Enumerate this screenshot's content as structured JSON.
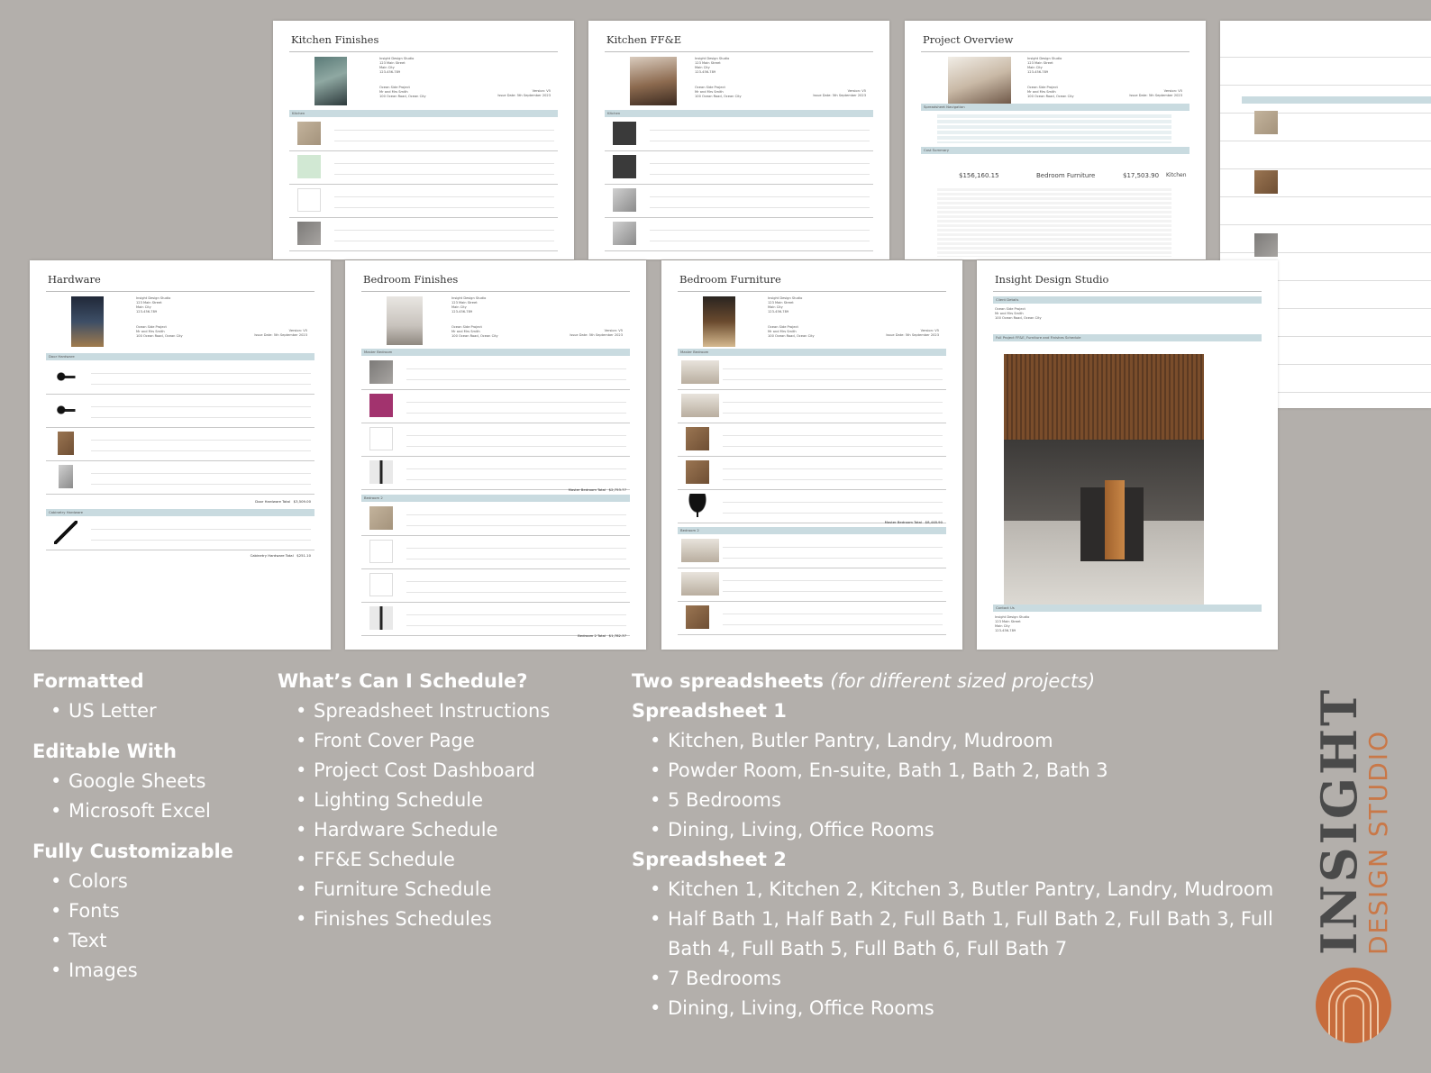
{
  "pages": {
    "kitchen_finishes": {
      "title": "Kitchen Finishes",
      "section": "Kitchen",
      "address": "Insight Design Studio\n123 Main Street\nMain City\n123-456-789",
      "project": "Ocean Side Project\nMr and Mrs Smith\n100 Ocean Road, Ocean City",
      "version": "Version: V5\nIssue Date: 5th September 2023"
    },
    "kitchen_ffe": {
      "title": "Kitchen FF&E",
      "section": "Kitchen",
      "address": "Insight Design Studio\n123 Main Street\nMain City\n123-456-789",
      "project": "Ocean Side Project\nMr and Mrs Smith\n100 Ocean Road, Ocean City",
      "version": "Version: V5\nIssue Date: 5th September 2023"
    },
    "project_overview": {
      "title": "Project Overview",
      "address": "Insight Design Studio\n123 Main Street\nMain City\n123-456-789",
      "project": "Ocean Side Project\nMr and Mrs Smith\n100 Ocean Road, Ocean City",
      "version": "Version: V5\nIssue Date: 5th September 2023",
      "nav_label": "Spreadsheet Navigation",
      "cost_label": "Cost Summary",
      "total_cost": "$156,160.15",
      "biggest_area": "Bedroom Furniture",
      "biggest_value": "$17,503.90",
      "biggest_room": "Kitchen"
    },
    "hardware": {
      "title": "Hardware",
      "section_1": "Door Hardware",
      "section_2": "Cabinetry Hardware",
      "address": "Insight Design Studio\n123 Main Street\nMain City\n123-456-789",
      "project": "Ocean Side Project\nMr and Mrs Smith\n100 Ocean Road, Ocean City",
      "version": "Version: V5\nIssue Date: 5th September 2023",
      "total_1_label": "Door Hardware Total",
      "total_1": "$3,509.00",
      "total_2_label": "Cabinetry Hardware Total",
      "total_2": "$251.10"
    },
    "bedroom_finishes": {
      "title": "Bedroom Finishes",
      "section_1": "Master Bedroom",
      "section_2": "Bedroom 2",
      "address": "Insight Design Studio\n123 Main Street\nMain City\n123-456-789",
      "project": "Ocean Side Project\nMr and Mrs Smith\n100 Ocean Road, Ocean City",
      "version": "Version: V5\nIssue Date: 5th September 2023",
      "total_1_label": "Master Bedroom Total",
      "total_1": "$2,753.77",
      "total_2_label": "Bedroom 2 Total",
      "total_2": "$1,782.37"
    },
    "bedroom_furniture": {
      "title": "Bedroom Furniture",
      "section_1": "Master Bedroom",
      "section_2": "Bedroom 2",
      "address": "Insight Design Studio\n123 Main Street\nMain City\n123-456-789",
      "project": "Ocean Side Project\nMr and Mrs Smith\n100 Ocean Road, Ocean City",
      "version": "Version: V5\nIssue Date: 5th September 2023",
      "total_1_label": "Master Bedroom Total",
      "total_1": "$8,448.90"
    },
    "cover": {
      "title": "Insight Design Studio",
      "client_label": "Client Details",
      "client": "Ocean Side Project\nMr and Mrs Smith\n100 Ocean Road, Ocean City",
      "schedule_label": "Full Project FF&E, Furniture and Finishes Schedule",
      "contact_label": "Contact Us",
      "contact": "Insight Design Studio\n123 Main Street\nMain City\n123-456-789"
    }
  },
  "col1": {
    "formatted_heading": "Formatted",
    "formatted_items": [
      "US Letter"
    ],
    "editable_heading": "Editable With",
    "editable_items": [
      "Google Sheets",
      "Microsoft Excel"
    ],
    "custom_heading": "Fully Customizable",
    "custom_items": [
      "Colors",
      "Fonts",
      "Text",
      "Images"
    ]
  },
  "col2": {
    "heading": "What’s Can I Schedule?",
    "items": [
      "Spreadsheet Instructions",
      "Front Cover Page",
      "Project Cost Dashboard",
      "Lighting Schedule",
      "Hardware Schedule",
      "FF&E Schedule",
      "Furniture Schedule",
      "Finishes Schedules"
    ]
  },
  "col3": {
    "heading": "Two spreadsheets",
    "heading_note": "(for different sized projects)",
    "s1_heading": "Spreadsheet 1",
    "s1_items": [
      "Kitchen, Butler Pantry, Landry, Mudroom",
      "Powder Room, En-suite, Bath 1, Bath 2, Bath 3",
      "5 Bedrooms",
      "Dining, Living, Office Rooms"
    ],
    "s2_heading": "Spreadsheet 2",
    "s2_items": [
      "Kitchen 1, Kitchen 2, Kitchen 3, Butler Pantry, Landry, Mudroom",
      "Half Bath 1, Half Bath 2, Full Bath 1, Full Bath 2, Full Bath 3, Full Bath 4, Full Bath 5, Full Bath 6, Full Bath 7",
      "7 Bedrooms",
      "Dining, Living, Office Rooms"
    ]
  },
  "brand": {
    "word_1": "INSIGHT",
    "word_2": "DESIGN STUDIO",
    "color_dark": "#4a4a4a",
    "color_accent": "#c97848"
  }
}
